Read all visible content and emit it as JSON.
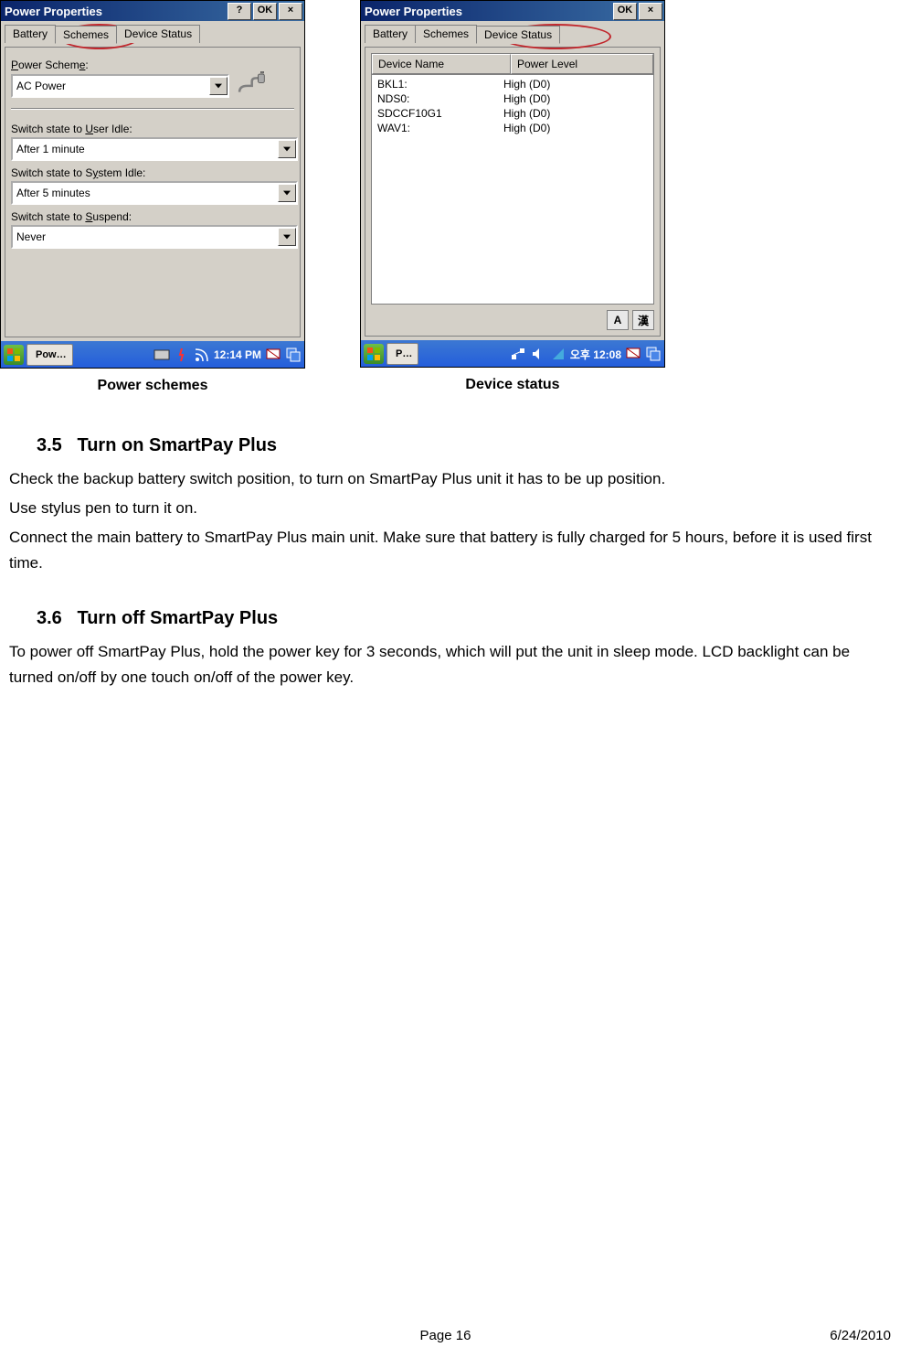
{
  "screenshot_left": {
    "window_title": "Power Properties",
    "title_buttons": {
      "help": "?",
      "ok": "OK",
      "close": "×"
    },
    "tabs": [
      "Battery",
      "Schemes",
      "Device Status"
    ],
    "selected_tab_index": 1,
    "label_scheme": "Power Scheme:",
    "scheme_value": "AC Power",
    "label_user_idle": "Switch state to User Idle:",
    "user_idle_value": "After 1 minute",
    "label_system_idle": "Switch state to System Idle:",
    "system_idle_value": "After 5 minutes",
    "label_suspend": "Switch state to Suspend:",
    "suspend_value": "Never",
    "taskbar_app": "Pow…",
    "taskbar_time": "12:14 PM",
    "caption": "Power schemes"
  },
  "screenshot_right": {
    "window_title": "Power Properties",
    "title_buttons": {
      "ok": "OK",
      "close": "×"
    },
    "tabs": [
      "Battery",
      "Schemes",
      "Device Status"
    ],
    "selected_tab_index": 2,
    "columns": {
      "a": "Device Name",
      "b": "Power Level"
    },
    "rows": [
      {
        "name": "BKL1:",
        "level": "High   (D0)"
      },
      {
        "name": "NDS0:",
        "level": "High   (D0)"
      },
      {
        "name": "SDCCF10G1",
        "level": "High   (D0)"
      },
      {
        "name": "WAV1:",
        "level": "High   (D0)"
      }
    ],
    "ime_buttons": [
      "A",
      "漢"
    ],
    "taskbar_app": "P…",
    "taskbar_time": "오후 12:08",
    "caption": "Device status"
  },
  "doc": {
    "h35_num": "3.5",
    "h35_title": "Turn on SmartPay Plus",
    "p35_1": "Check the backup battery switch position, to turn on SmartPay Plus unit it has to be up position.",
    "p35_2": "Use stylus pen to turn it on.",
    "p35_3": "Connect the main battery to SmartPay Plus main unit. Make sure that battery is fully charged for 5 hours, before it is used first time.",
    "h36_num": "3.6",
    "h36_title": "Turn off SmartPay Plus",
    "p36_1": "To power off SmartPay Plus, hold the power key for 3 seconds, which will put the unit in sleep mode. LCD backlight can be turned on/off by one touch on/off of the power key."
  },
  "footer": {
    "page": "Page 16",
    "date": "6/24/2010"
  }
}
